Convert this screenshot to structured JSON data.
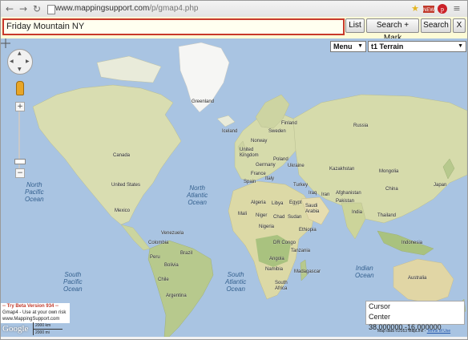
{
  "browser": {
    "url_host": "www.mappingsupport.com",
    "url_path": "/p/gmap4.php",
    "extensions": [
      "star-icon",
      "new-badge-icon",
      "pinterest-icon",
      "wrench-icon"
    ]
  },
  "toolbar": {
    "search_value": "Friday Mountain NY",
    "list_label": "List",
    "search_mark_label": "Search + Mark",
    "search_label": "Search",
    "close_label": "X"
  },
  "map_controls": {
    "menu_label": "Menu",
    "terrain_label": "t1 Terrain"
  },
  "map_labels": {
    "greenland": "Greenland",
    "iceland": "Iceland",
    "sweden": "Sweden",
    "norway": "Norway",
    "finland": "Finland",
    "united_kingdom": "United\nKingdom",
    "poland": "Poland",
    "germany": "Germany",
    "france": "France",
    "ukraine": "Ukraine",
    "italy": "Italy",
    "spain": "Spain",
    "turkey": "Turkey",
    "kazakhstan": "Kazakhstan",
    "mongolia": "Mongolia",
    "china": "China",
    "japan": "Japan",
    "afghanistan": "Afghanistan",
    "pakistan": "Pakistan",
    "iran": "Iran",
    "iraq": "Iraq",
    "india": "India",
    "thailand": "Thailand",
    "algeria": "Algeria",
    "libya": "Libya",
    "egypt": "Egypt",
    "saudi_arabia": "Saudi\nArabia",
    "mali": "Mali",
    "niger": "Niger",
    "chad": "Chad",
    "sudan": "Sudan",
    "nigeria": "Nigeria",
    "ethiopia": "Ethiopia",
    "dr_congo": "DR Congo",
    "tanzania": "Tanzania",
    "angola": "Angola",
    "namibia": "Namibia",
    "madagascar": "Madagascar",
    "south_africa": "South\nAfrica",
    "indonesia": "Indonesia",
    "australia": "Australia",
    "canada": "Canada",
    "united_states": "United States",
    "mexico": "Mexico",
    "venezuela": "Venezuela",
    "colombia": "Colombia",
    "peru": "Peru",
    "brazil": "Brazil",
    "bolivia": "Bolivia",
    "chile": "Chile",
    "argentina": "Argentina",
    "russia": "Russia"
  },
  "oceans": {
    "north_pacific": "North\nPacific\nOcean",
    "north_atlantic": "North\nAtlantic\nOcean",
    "south_pacific": "South\nPacific\nOcean",
    "south_atlantic": "South\nAtlantic\nOcean",
    "indian": "Indian\nOcean"
  },
  "beta_box": {
    "title": "-- Try Beta Version 934 --",
    "line1": "Gmap4 - Use at your own risk",
    "line2": "www.MappingSupport.com"
  },
  "google_logo": "Google",
  "scale": {
    "km": "2000 km",
    "mi": "2000 mi"
  },
  "cursor_box": {
    "cursor_label": "Cursor",
    "center_text": "Center 38.000000,-16.000000"
  },
  "attribution": {
    "text": "Map data ©2013 MapLink - ",
    "terms": "Terms of Use"
  },
  "colors": {
    "ocean": "#a9c4e2",
    "land": "#d8dcb0",
    "toolbar_bg": "#fdfbd7",
    "search_border": "#c8392b"
  }
}
